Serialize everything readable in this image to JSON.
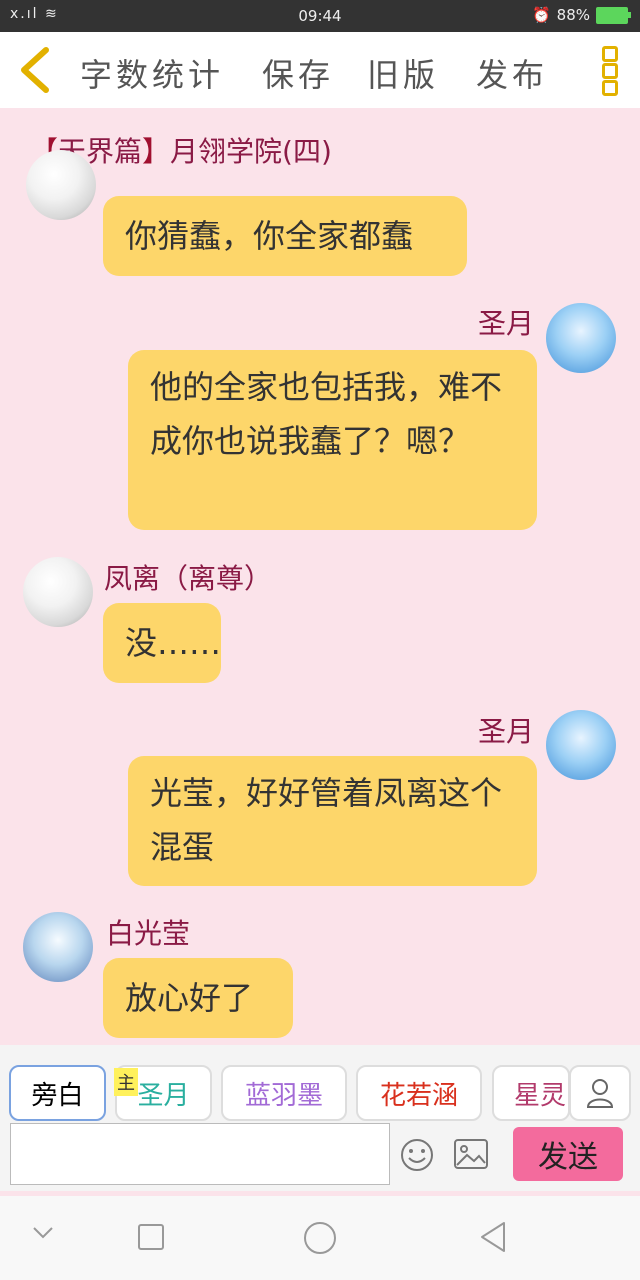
{
  "status": {
    "time": "09:44",
    "battery": "88%"
  },
  "toolbar": {
    "word_count": "字数统计",
    "save": "保存",
    "old_version": "旧版",
    "publish": "发布"
  },
  "chapter_title": {
    "bracket_open": "【",
    "volume": "天界篇",
    "bracket_close": "】",
    "title": "月翎学院(四)"
  },
  "messages": [
    {
      "text": "你猜蠢，你全家都蠢"
    },
    {
      "name": "圣月",
      "text": "他的全家也包括我，难不成你也说我蠢了？嗯？"
    },
    {
      "name": "凤离（离尊）",
      "text": "没……"
    },
    {
      "name": "圣月",
      "text": "光莹，好好管着凤离这个混蛋"
    },
    {
      "name": "白光莹",
      "text": "放心好了"
    }
  ],
  "characters": [
    {
      "label": "旁白",
      "color": "#333333"
    },
    {
      "label": "圣月",
      "color": "#2aaf9f"
    },
    {
      "label": "蓝羽墨",
      "color": "#a26ad6"
    },
    {
      "label": "花若涵",
      "color": "#d9301d"
    },
    {
      "label": "星灵",
      "color": "#b23a6b"
    }
  ],
  "main_tag": "主",
  "send_label": "发送",
  "colors": {
    "bubble": "#fdd66a",
    "background": "#fbe3ea",
    "send": "#f36b9d"
  }
}
